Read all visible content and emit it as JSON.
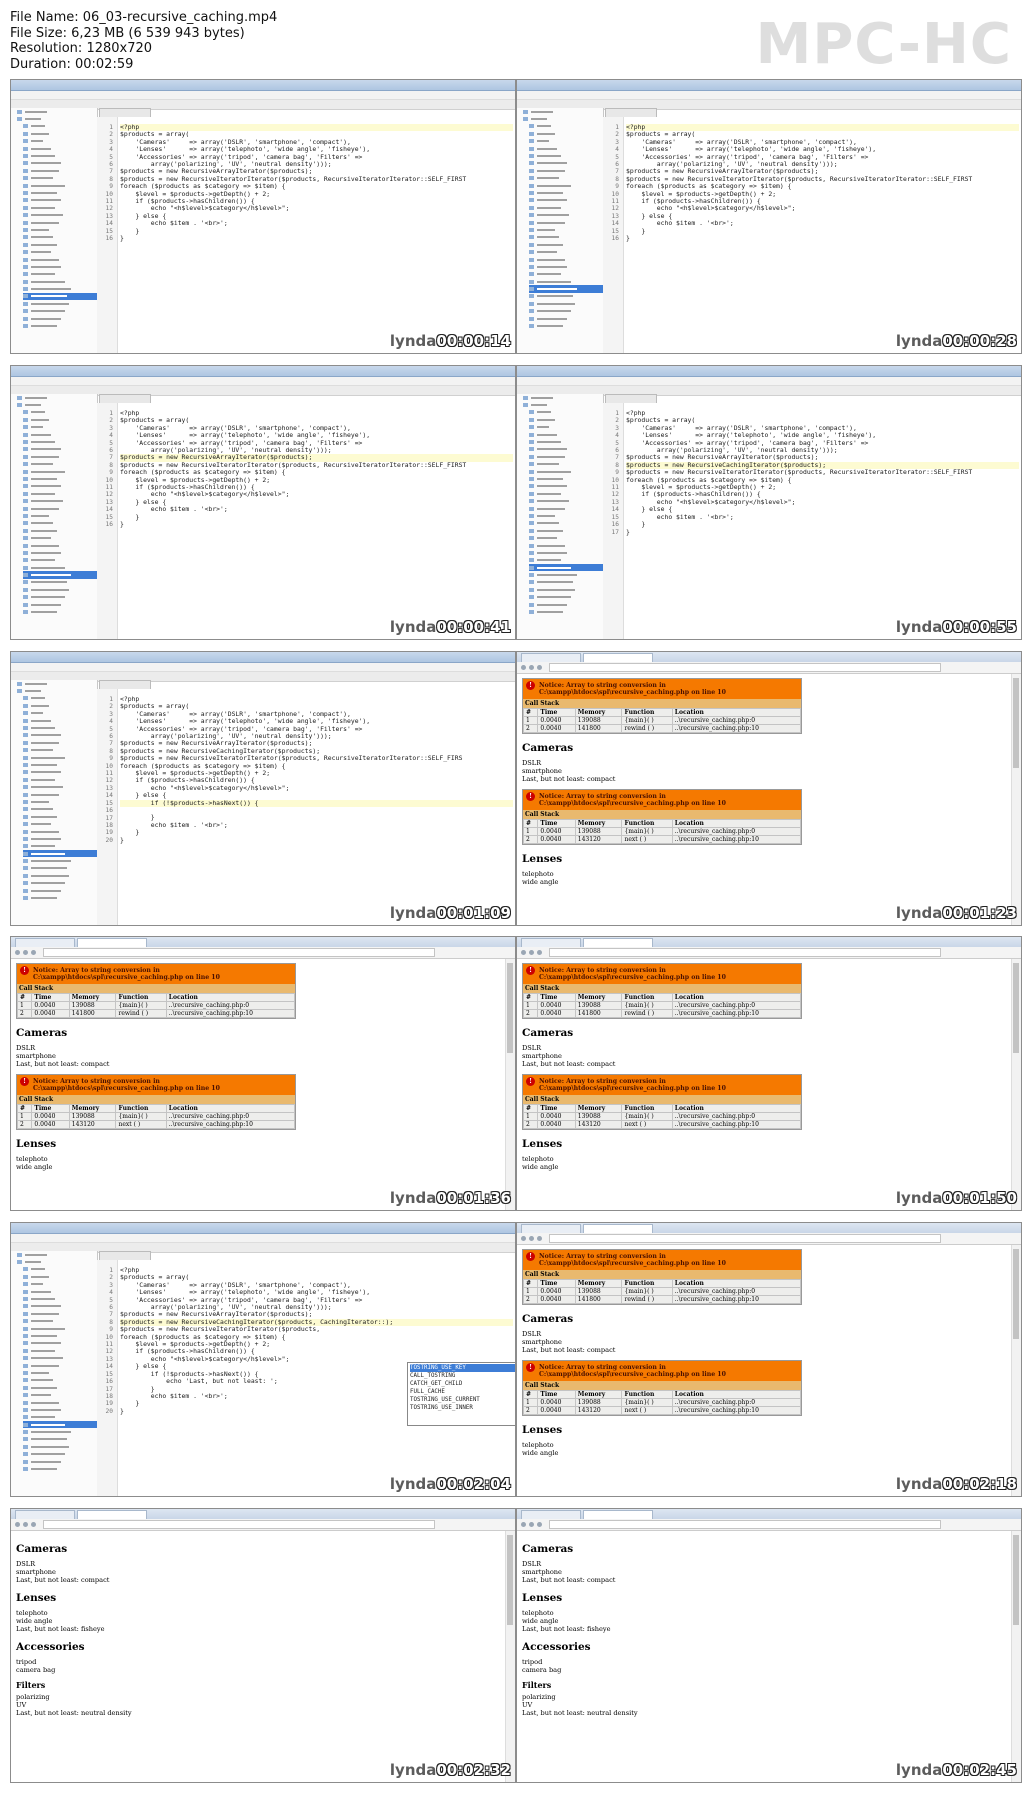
{
  "file_info": {
    "name_line": "File Name: 06_03-recursive_caching.mp4",
    "size_line": "File Size: 6,23 MB (6 539 943 bytes)",
    "resolution_line": "Resolution: 1280x720",
    "duration_line": "Duration: 00:02:59"
  },
  "logo": "MPC-HC",
  "watermark": "lynda",
  "code_v1": [
    "<?php",
    "$products = array(",
    "    'Cameras'     => array('DSLR', 'smartphone', 'compact'),",
    "    'Lenses'      => array('telephoto', 'wide angle', 'fisheye'),",
    "    'Accessories' => array('tripod', 'camera bag', 'Filters' =>",
    "        array('polarizing', 'UV', 'neutral density')));",
    "$products = new RecursiveArrayIterator($products);",
    "$products = new RecursiveIteratorIterator($products, RecursiveIteratorIterator::SELF_FIRST",
    "foreach ($products as $category => $item) {",
    "    $level = $products->getDepth() + 2;",
    "    if ($products->hasChildren()) {",
    "        echo \"<h$level>$category</h$level>\";",
    "    } else {",
    "        echo $item . '<br>';",
    "    }",
    "}"
  ],
  "code_v2": [
    "<?php",
    "$products = array(",
    "    'Cameras'     => array('DSLR', 'smartphone', 'compact'),",
    "    'Lenses'      => array('telephoto', 'wide angle', 'fisheye'),",
    "    'Accessories' => array('tripod', 'camera bag', 'Filters' =>",
    "        array('polarizing', 'UV', 'neutral density')));",
    "$products = new RecursiveArrayIterator($products);",
    "$products = new RecursiveCachingIterator($products);",
    "$products = new RecursiveIteratorIterator($products, RecursiveIteratorIterator::SELF_FIRST",
    "foreach ($products as $category => $item) {",
    "    $level = $products->getDepth() + 2;",
    "    if ($products->hasChildren()) {",
    "        echo \"<h$level>$category</h$level>\";",
    "    } else {",
    "        echo $item . '<br>';",
    "    }",
    "}"
  ],
  "code_v3": [
    "<?php",
    "$products = array(",
    "    'Cameras'     => array('DSLR', 'smartphone', 'compact'),",
    "    'Lenses'      => array('telephoto', 'wide angle', 'fisheye'),",
    "    'Accessories' => array('tripod', 'camera bag', 'Filters' =>",
    "        array('polarizing', 'UV', 'neutral density')));",
    "$products = new RecursiveArrayIterator($products);",
    "$products = new RecursiveCachingIterator($products);",
    "$products = new RecursiveIteratorIterator($products, RecursiveIteratorIterator::SELF_FIRS",
    "foreach ($products as $category => $item) {",
    "    $level = $products->getDepth() + 2;",
    "    if ($products->hasChildren()) {",
    "        echo \"<h$level>$category</h$level>\";",
    "    } else {",
    "        if (!$products->hasNext()) {",
    "",
    "        }",
    "        echo $item . '<br>';",
    "    }",
    "}"
  ],
  "code_v4": [
    "<?php",
    "$products = array(",
    "    'Cameras'     => array('DSLR', 'smartphone', 'compact'),",
    "    'Lenses'      => array('telephoto', 'wide angle', 'fisheye'),",
    "    'Accessories' => array('tripod', 'camera bag', 'Filters' =>",
    "        array('polarizing', 'UV', 'neutral density')));",
    "$products = new RecursiveArrayIterator($products);",
    "$products = new RecursiveCachingIterator($products, CachingIterator::);",
    "$products = new RecursiveIteratorIterator($products,",
    "foreach ($products as $category => $item) {",
    "    $level = $products->getDepth() + 2;",
    "    if ($products->hasChildren()) {",
    "        echo \"<h$level>$category</h$level>\";",
    "    } else {",
    "        if (!$products->hasNext()) {",
    "            echo 'Last, but not least: ';",
    "        }",
    "        echo $item . '<br>';",
    "    }",
    "}"
  ],
  "autocomplete_items": [
    {
      "name": "TOSTRING_USE_KEY",
      "type": "int"
    },
    {
      "name": "CALL_TOSTRING",
      "type": "int"
    },
    {
      "name": "CATCH_GET_CHILD",
      "type": "int"
    },
    {
      "name": "FULL_CACHE",
      "type": "int"
    },
    {
      "name": "TOSTRING_USE_CURRENT",
      "type": "int"
    },
    {
      "name": "TOSTRING_USE_INNER",
      "type": "int"
    }
  ],
  "xdebug": {
    "notice": "Notice: Array to string conversion in C:\\xampp\\htdocs\\spl\\recursive_caching.php on line 10",
    "call_stack": "Call Stack",
    "headers": [
      "#",
      "Time",
      "Memory",
      "Function",
      "Location"
    ],
    "rows_a": [
      [
        "1",
        "0.0040",
        "139088",
        "{main}( )",
        "..\\recursive_caching.php:0"
      ],
      [
        "2",
        "0.0040",
        "141800",
        "rewind ( )",
        "..\\recursive_caching.php:10"
      ]
    ],
    "rows_b": [
      [
        "1",
        "0.0040",
        "139088",
        "{main}( )",
        "..\\recursive_caching.php:0"
      ],
      [
        "2",
        "0.0040",
        "143120",
        "next ( )",
        "..\\recursive_caching.php:10"
      ]
    ]
  },
  "output_partial": {
    "cameras": "Cameras",
    "cameras_items": [
      "DSLR",
      "smartphone",
      "Last, but not least: compact"
    ],
    "lenses": "Lenses",
    "lenses_items": [
      "telephoto",
      "wide angle"
    ]
  },
  "output_final": {
    "cameras": "Cameras",
    "cameras_items": [
      "DSLR",
      "smartphone",
      "Last, but not least: compact"
    ],
    "lenses": "Lenses",
    "lenses_items": [
      "telephoto",
      "wide angle",
      "Last, but not least: fisheye"
    ],
    "accessories": "Accessories",
    "accessories_items": [
      "tripod",
      "camera bag"
    ],
    "filters": "Filters",
    "filters_items": [
      "polarizing",
      "UV",
      "Last, but not least: neutral density"
    ]
  },
  "thumbnails": [
    {
      "time": "00:00:14"
    },
    {
      "time": "00:00:28"
    },
    {
      "time": "00:00:41"
    },
    {
      "time": "00:00:55"
    },
    {
      "time": "00:01:09"
    },
    {
      "time": "00:01:23"
    },
    {
      "time": "00:01:36"
    },
    {
      "time": "00:01:50"
    },
    {
      "time": "00:02:04"
    },
    {
      "time": "00:02:18"
    },
    {
      "time": "00:02:32"
    },
    {
      "time": "00:02:45"
    }
  ]
}
